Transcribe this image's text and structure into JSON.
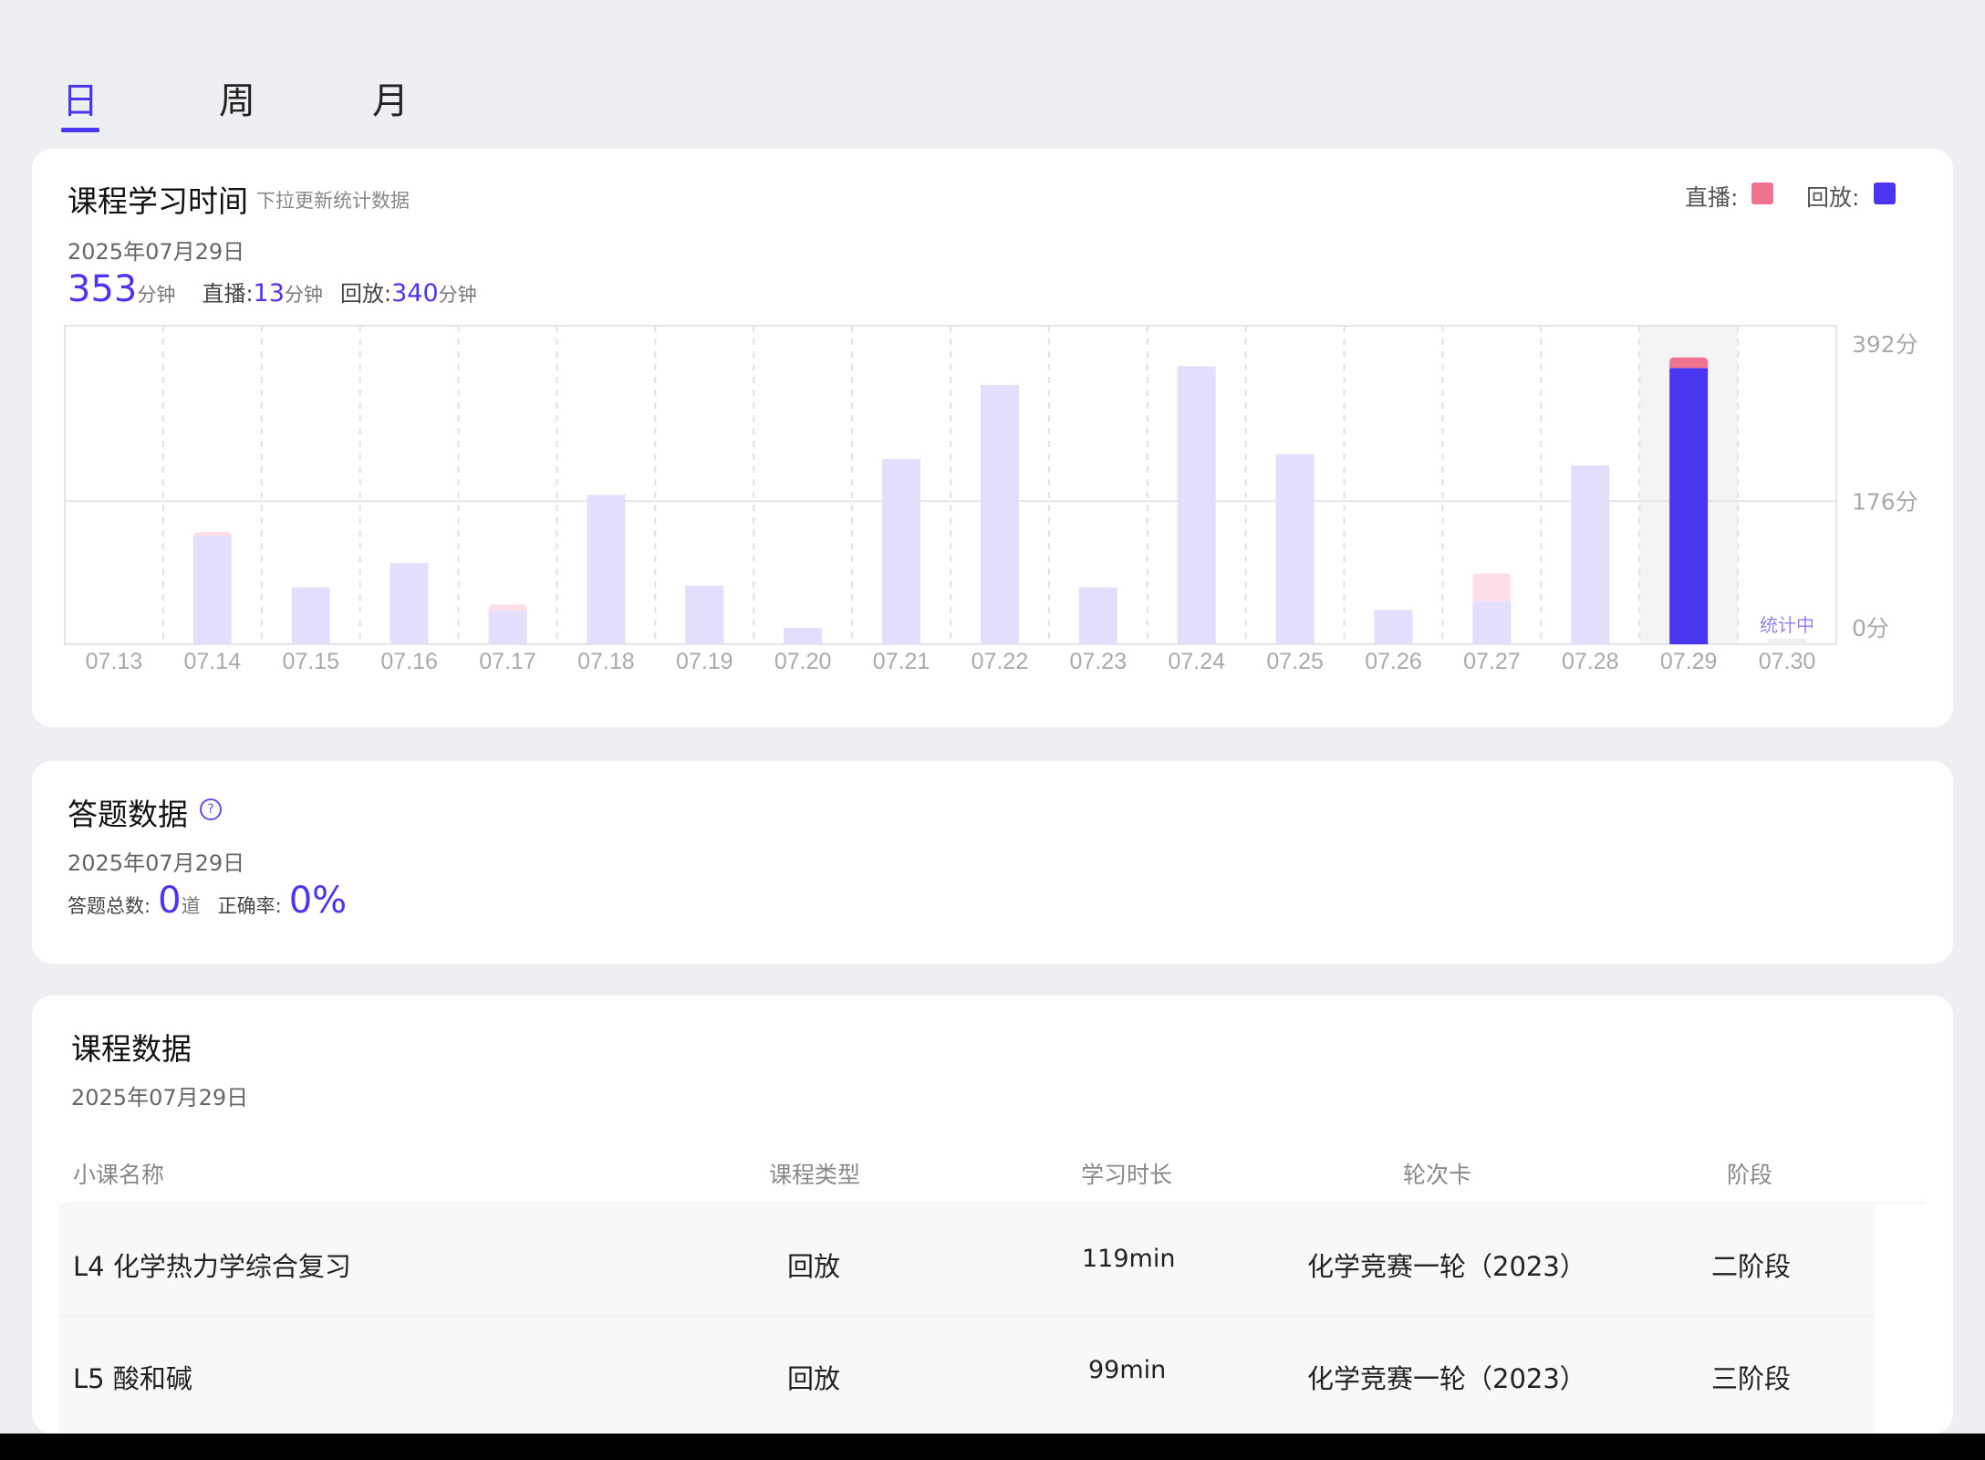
{
  "tabs": [
    {
      "label": "日",
      "active": true
    },
    {
      "label": "周",
      "active": false
    },
    {
      "label": "月",
      "active": false
    }
  ],
  "study_time": {
    "title": "课程学习时间",
    "subtitle": "下拉更新统计数据",
    "legend": {
      "live_label": "直播:",
      "replay_label": "回放:"
    },
    "date": "2025年07月29日",
    "total": "353",
    "total_unit": "分钟",
    "live_label": "直播:",
    "live_value": "13",
    "live_unit": "分钟",
    "replay_label": "回放:",
    "replay_value": "340",
    "replay_unit": "分钟"
  },
  "chart_data": {
    "type": "bar",
    "stacked": true,
    "categories": [
      "07.13",
      "07.14",
      "07.15",
      "07.16",
      "07.17",
      "07.18",
      "07.19",
      "07.20",
      "07.21",
      "07.22",
      "07.23",
      "07.24",
      "07.25",
      "07.26",
      "07.27",
      "07.28",
      "07.29",
      "07.30"
    ],
    "series": [
      {
        "name": "回放",
        "values": [
          0,
          134,
          70,
          100,
          41,
          184,
          72,
          20,
          228,
          319,
          70,
          342,
          234,
          42,
          53,
          220,
          340,
          0
        ]
      },
      {
        "name": "直播",
        "values": [
          0,
          4,
          0,
          0,
          8,
          0,
          0,
          0,
          0,
          0,
          0,
          0,
          0,
          0,
          34,
          0,
          13,
          0
        ]
      }
    ],
    "y_ticks": [
      "392分",
      "176分",
      "0分"
    ],
    "ylim": [
      0,
      392
    ],
    "selected": "07.29",
    "pending_label": "统计中",
    "grid": true,
    "colors": {
      "live": "#f0728f",
      "replay": "#4a35f0",
      "live_dim": "#ffdde6",
      "replay_dim": "#e2defc"
    }
  },
  "answers": {
    "title": "答题数据",
    "help_icon": "question-circle-icon",
    "help_glyph": "?",
    "date": "2025年07月29日",
    "total_label": "答题总数:",
    "total_value": "0",
    "total_unit": "道",
    "accuracy_label": "正确率:",
    "accuracy_value": "0%"
  },
  "courses": {
    "title": "课程数据",
    "date": "2025年07月29日",
    "headers": [
      "小课名称",
      "课程类型",
      "学习时长",
      "轮次卡",
      "阶段"
    ],
    "rows": [
      {
        "name": "L4 化学热力学综合复习",
        "type": "回放",
        "duration": "119min",
        "round": "化学竞赛一轮（2023）",
        "stage": "二阶段"
      },
      {
        "name": "L5 酸和碱",
        "type": "回放",
        "duration": "99min",
        "round": "化学竞赛一轮（2023）",
        "stage": "三阶段"
      }
    ]
  }
}
